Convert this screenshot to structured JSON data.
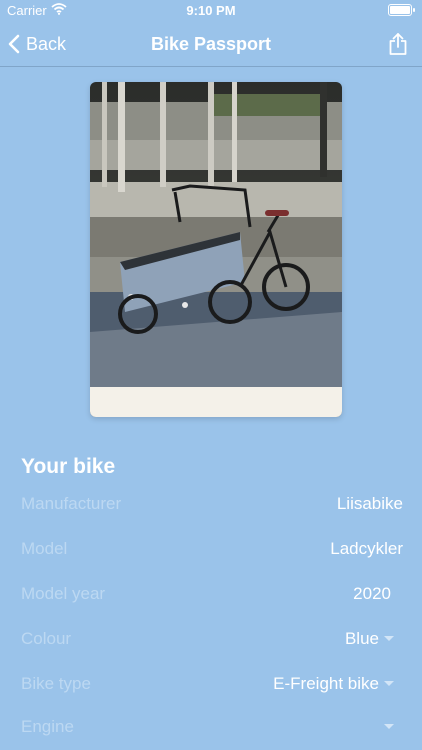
{
  "status_bar": {
    "carrier": "Carrier",
    "time": "9:10 PM"
  },
  "nav": {
    "back_label": "Back",
    "title": "Bike Passport"
  },
  "section": {
    "title": "Your bike"
  },
  "fields": {
    "manufacturer": {
      "label": "Manufacturer",
      "value": "Liisabike"
    },
    "model": {
      "label": "Model",
      "value": "Ladcykler"
    },
    "model_year": {
      "label": "Model year",
      "value": "2020"
    },
    "colour": {
      "label": "Colour",
      "value": "Blue"
    },
    "bike_type": {
      "label": "Bike type",
      "value": "E-Freight bike"
    },
    "engine": {
      "label": "Engine",
      "value": ""
    }
  },
  "colors": {
    "background": "#9ac3ea",
    "text": "#ffffff",
    "label_text": "#bcd8f2"
  }
}
